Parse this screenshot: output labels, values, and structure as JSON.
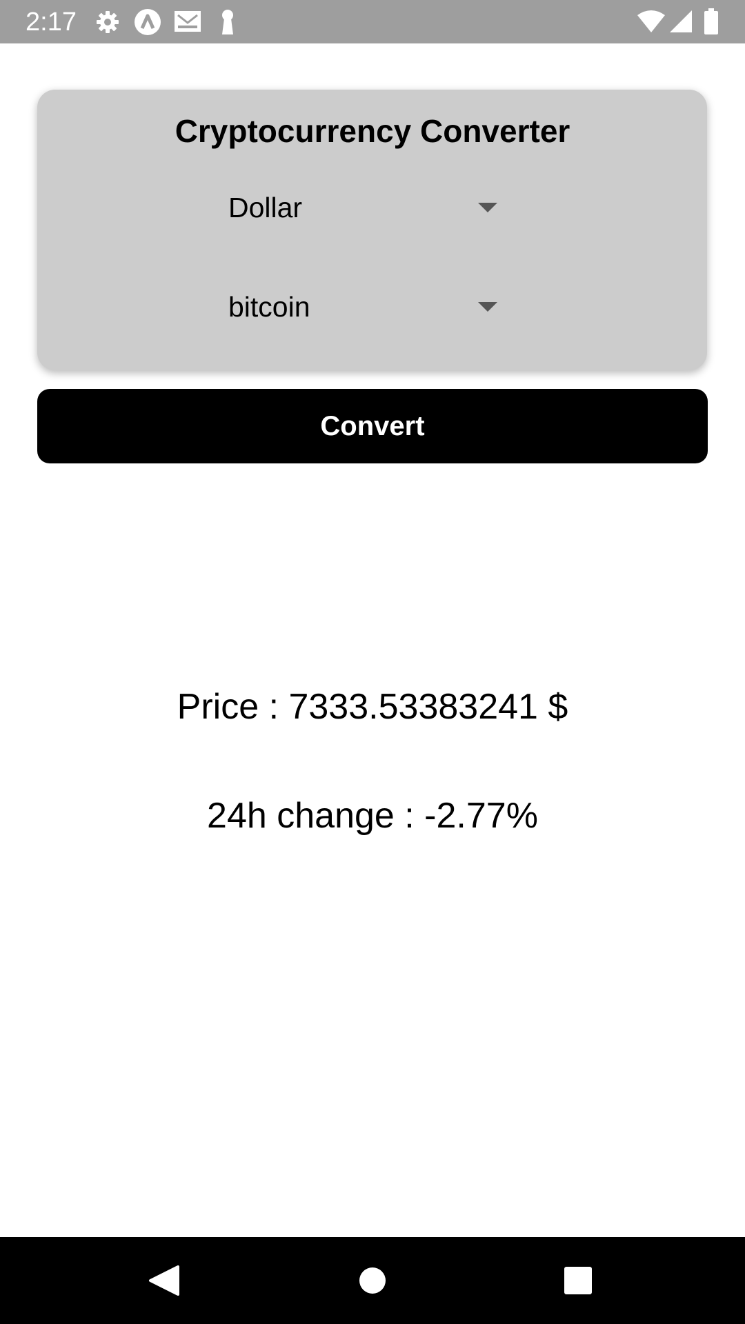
{
  "status_bar": {
    "time": "2:17",
    "icons": [
      "gear-icon",
      "app-a-icon",
      "gmail-icon",
      "keyhole-icon",
      "wifi-icon",
      "signal-icon",
      "battery-icon"
    ],
    "background": "#9e9e9e"
  },
  "converter": {
    "title": "Cryptocurrency Converter",
    "currency_picker": {
      "selected": "Dollar"
    },
    "crypto_picker": {
      "selected": "bitcoin"
    },
    "card_color": "#cccccc"
  },
  "convert_button": {
    "label": "Convert",
    "background": "#000000",
    "text_color": "#ffffff"
  },
  "result": {
    "price": "Price : 7333.53383241 $",
    "change": "24h change : -2.77%"
  },
  "nav_bar": {
    "buttons": [
      "back-icon",
      "home-icon",
      "recents-icon"
    ],
    "background": "#000000"
  }
}
